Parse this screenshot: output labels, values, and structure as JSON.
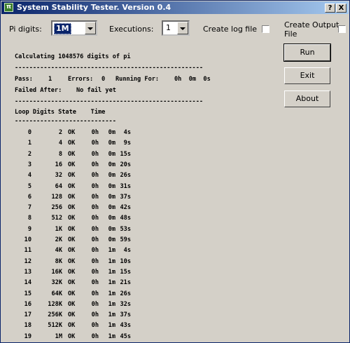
{
  "window": {
    "title": "System Stability Tester. Version 0.4",
    "help_label": "?",
    "close_label": "X"
  },
  "controls": {
    "pi_digits_label": "Pi digits:",
    "pi_digits_value": "1M",
    "executions_label": "Executions:",
    "executions_value": "1",
    "create_log_label": "Create log file",
    "create_log_checked": false,
    "create_output_label_1": "Create Output",
    "create_output_label_2": "File",
    "create_output_checked": false
  },
  "buttons": {
    "run": "Run",
    "exit": "Exit",
    "about": "About"
  },
  "console": {
    "calculating": "Calculating 1048576 digits of pi",
    "separator": "----------------------------------------------------",
    "pass_label": "Pass:",
    "pass_value": "1",
    "errors_label": "Errors:",
    "errors_value": "0",
    "running_label": "Running For:",
    "running_value": "0h  0m  0s",
    "failed_label": "Failed After:",
    "failed_value": "No fail yet",
    "table_header": "Loop Digits State    Time",
    "table_separator": "----------------------------",
    "rows": [
      {
        "loop": "0",
        "digits": "2",
        "state": "OK",
        "h": "0h",
        "m": "0m",
        "s": "4s"
      },
      {
        "loop": "1",
        "digits": "4",
        "state": "OK",
        "h": "0h",
        "m": "0m",
        "s": "9s"
      },
      {
        "loop": "2",
        "digits": "8",
        "state": "OK",
        "h": "0h",
        "m": "0m",
        "s": "15s"
      },
      {
        "loop": "3",
        "digits": "16",
        "state": "OK",
        "h": "0h",
        "m": "0m",
        "s": "20s"
      },
      {
        "loop": "4",
        "digits": "32",
        "state": "OK",
        "h": "0h",
        "m": "0m",
        "s": "26s"
      },
      {
        "loop": "5",
        "digits": "64",
        "state": "OK",
        "h": "0h",
        "m": "0m",
        "s": "31s"
      },
      {
        "loop": "6",
        "digits": "128",
        "state": "OK",
        "h": "0h",
        "m": "0m",
        "s": "37s"
      },
      {
        "loop": "7",
        "digits": "256",
        "state": "OK",
        "h": "0h",
        "m": "0m",
        "s": "42s"
      },
      {
        "loop": "8",
        "digits": "512",
        "state": "OK",
        "h": "0h",
        "m": "0m",
        "s": "48s"
      },
      {
        "loop": "9",
        "digits": "1K",
        "state": "OK",
        "h": "0h",
        "m": "0m",
        "s": "53s"
      },
      {
        "loop": "10",
        "digits": "2K",
        "state": "OK",
        "h": "0h",
        "m": "0m",
        "s": "59s"
      },
      {
        "loop": "11",
        "digits": "4K",
        "state": "OK",
        "h": "0h",
        "m": "1m",
        "s": "4s"
      },
      {
        "loop": "12",
        "digits": "8K",
        "state": "OK",
        "h": "0h",
        "m": "1m",
        "s": "10s"
      },
      {
        "loop": "13",
        "digits": "16K",
        "state": "OK",
        "h": "0h",
        "m": "1m",
        "s": "15s"
      },
      {
        "loop": "14",
        "digits": "32K",
        "state": "OK",
        "h": "0h",
        "m": "1m",
        "s": "21s"
      },
      {
        "loop": "15",
        "digits": "64K",
        "state": "OK",
        "h": "0h",
        "m": "1m",
        "s": "26s"
      },
      {
        "loop": "16",
        "digits": "128K",
        "state": "OK",
        "h": "0h",
        "m": "1m",
        "s": "32s"
      },
      {
        "loop": "17",
        "digits": "256K",
        "state": "OK",
        "h": "0h",
        "m": "1m",
        "s": "37s"
      },
      {
        "loop": "18",
        "digits": "512K",
        "state": "OK",
        "h": "0h",
        "m": "1m",
        "s": "43s"
      },
      {
        "loop": "19",
        "digits": "1M",
        "state": "OK",
        "h": "0h",
        "m": "1m",
        "s": "45s"
      }
    ]
  }
}
